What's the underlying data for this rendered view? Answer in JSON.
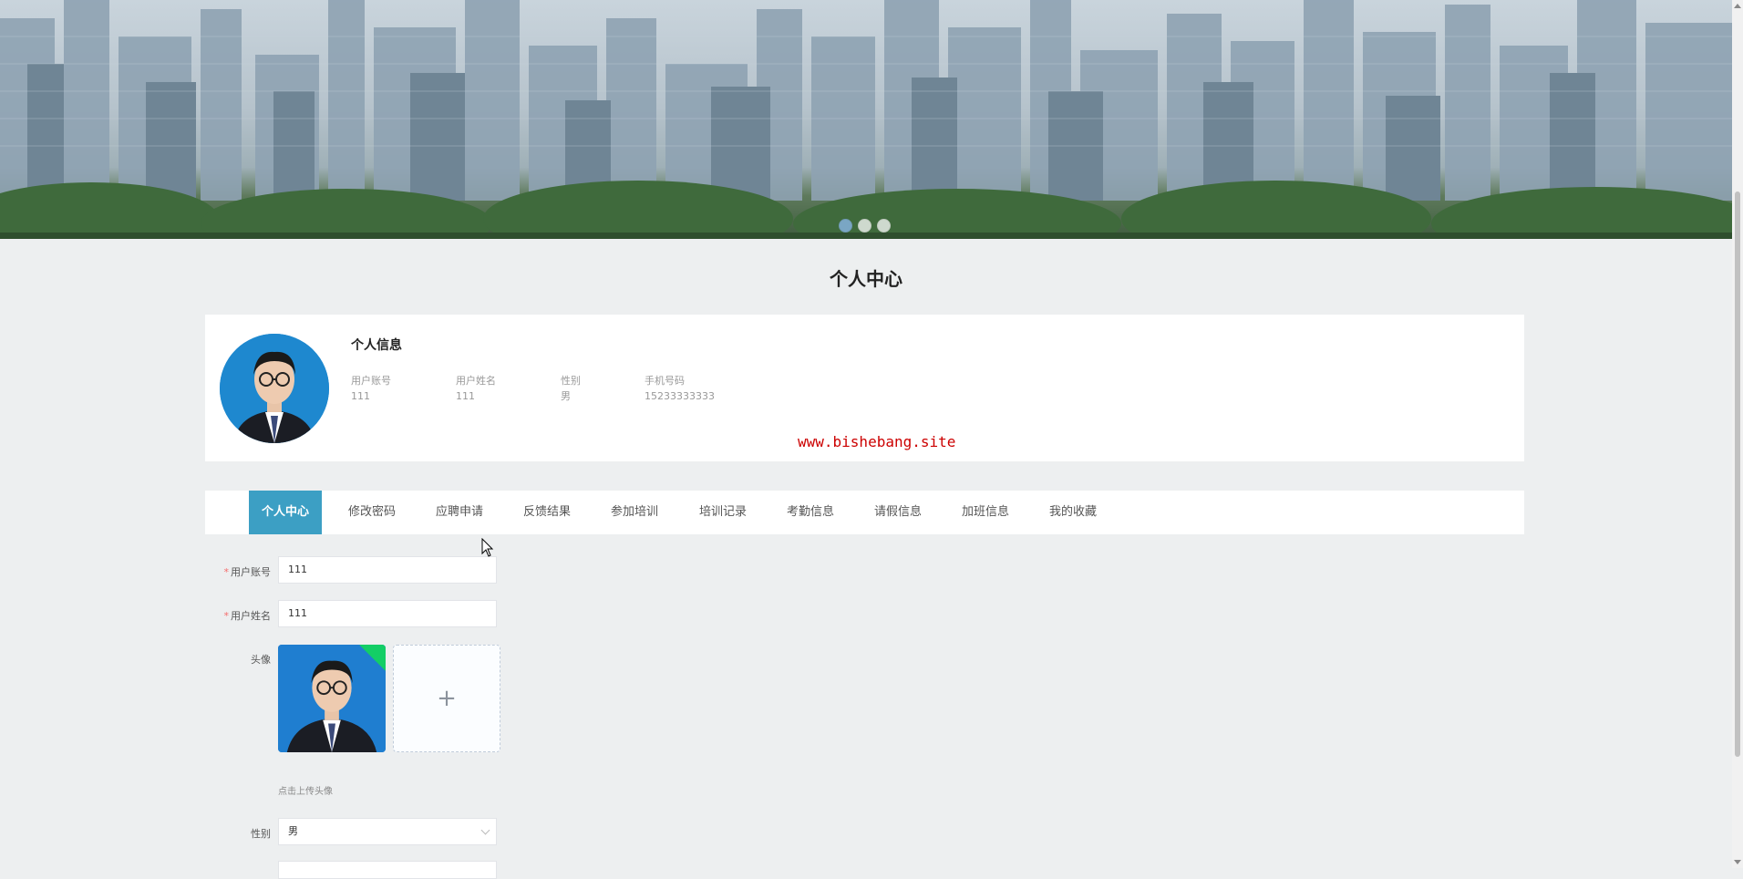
{
  "banner": {
    "slide_count": 3,
    "active_slide": 0
  },
  "page": {
    "title": "个人中心"
  },
  "profile": {
    "section_title": "个人信息",
    "fields": [
      {
        "label": "用户账号",
        "value": "111"
      },
      {
        "label": "用户姓名",
        "value": "111"
      },
      {
        "label": "性别",
        "value": "男"
      },
      {
        "label": "手机号码",
        "value": "15233333333"
      }
    ],
    "watermark": "www.bishebang.site"
  },
  "tabs": [
    {
      "label": "个人中心",
      "active": true
    },
    {
      "label": "修改密码"
    },
    {
      "label": "应聘申请"
    },
    {
      "label": "反馈结果"
    },
    {
      "label": "参加培训"
    },
    {
      "label": "培训记录"
    },
    {
      "label": "考勤信息"
    },
    {
      "label": "请假信息"
    },
    {
      "label": "加班信息"
    },
    {
      "label": "我的收藏"
    }
  ],
  "form": {
    "account": {
      "label": "用户账号",
      "value": "111",
      "required": true
    },
    "name": {
      "label": "用户姓名",
      "value": "111",
      "required": true
    },
    "avatar": {
      "label": "头像",
      "tip": "点击上传头像",
      "add_symbol": "+"
    },
    "gender": {
      "label": "性别",
      "value": "男"
    }
  },
  "colors": {
    "accent": "#3c9fc4",
    "watermark": "#cc0000",
    "required": "#f56c6c"
  }
}
